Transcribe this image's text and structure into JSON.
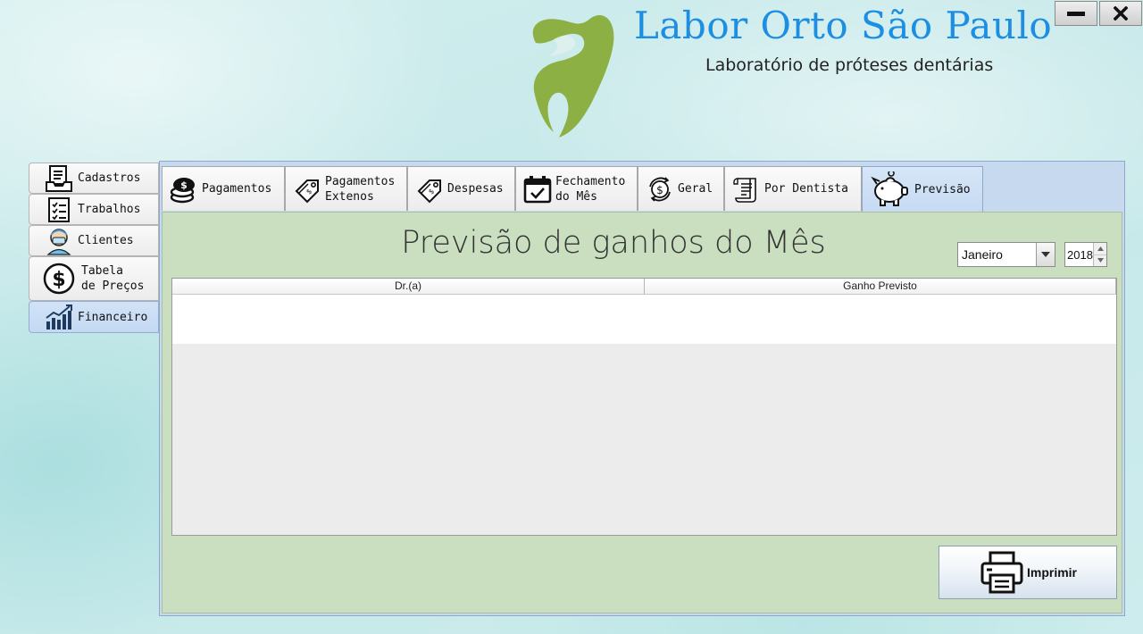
{
  "window": {
    "minimize_icon": "minimize-icon",
    "close_icon": "close-icon"
  },
  "brand": {
    "title": "Labor Orto São Paulo",
    "subtitle": "Laboratório de próteses dentárias",
    "logo_icon": "tooth-logo-icon",
    "logo_color": "#8cb043",
    "title_color": "#1d8fe3"
  },
  "sidebar": {
    "items": [
      {
        "label": "Cadastros",
        "icon": "register-icon"
      },
      {
        "label": "Trabalhos",
        "icon": "checklist-icon"
      },
      {
        "label": "Clientes",
        "icon": "dentist-icon"
      },
      {
        "label": "Tabela\nde Preços",
        "icon": "dollar-icon"
      },
      {
        "label": "Financeiro",
        "icon": "chart-growth-icon",
        "active": true
      }
    ]
  },
  "tabs": [
    {
      "label": "Pagamentos",
      "icon": "coins-icon"
    },
    {
      "label": "Pagamentos\nExtenos",
      "icon": "price-tag-icon"
    },
    {
      "label": "Despesas",
      "icon": "price-tag-icon"
    },
    {
      "label": "Fechamento\ndo Mês",
      "icon": "calendar-check-icon"
    },
    {
      "label": "Geral",
      "icon": "money-cycle-icon"
    },
    {
      "label": "Por Dentista",
      "icon": "receipt-icon"
    },
    {
      "label": "Previsão",
      "icon": "piggy-bank-icon",
      "active": true
    }
  ],
  "content": {
    "title": "Previsão de ganhos do Mês",
    "month": {
      "selected": "Janeiro"
    },
    "year": {
      "value": "2018"
    },
    "table": {
      "columns": [
        "Dr.(a)",
        "Ganho Previsto"
      ],
      "rows": []
    },
    "print_label": "Imprimir",
    "background": "#c9dfc0",
    "accent": "#c7d9ef"
  }
}
